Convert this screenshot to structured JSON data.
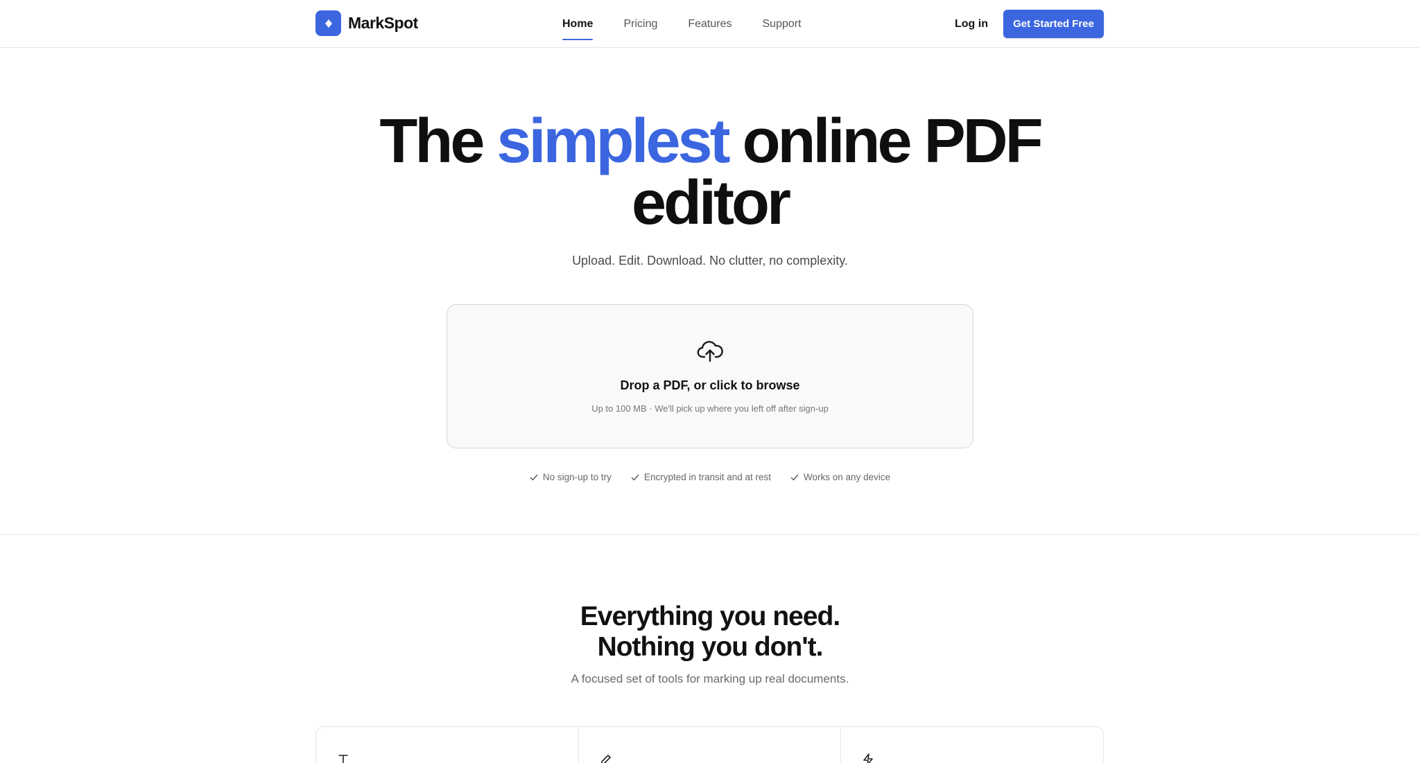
{
  "brand": {
    "name": "MarkSpot",
    "color": "#3b66e0"
  },
  "nav": {
    "items": [
      {
        "label": "Home",
        "active": true
      },
      {
        "label": "Pricing",
        "active": false
      },
      {
        "label": "Features",
        "active": false
      },
      {
        "label": "Support",
        "active": false
      }
    ],
    "login_label": "Log in",
    "cta_label": "Get Started Free"
  },
  "hero": {
    "title_before": "The ",
    "title_accent": "simplest",
    "title_after_line1": " online PDF",
    "title_line2": "editor",
    "subtitle": "Upload. Edit. Download. No clutter, no complexity."
  },
  "dropzone": {
    "icon": "cloud-upload-icon",
    "title": "Drop a PDF, or click to browse",
    "subtitle": "Up to 100 MB · We'll pick up where you left off after sign-up"
  },
  "assurances": [
    "No sign-up to try",
    "Encrypted in transit and at rest",
    "Works on any device"
  ],
  "features_section": {
    "title_line1": "Everything you need.",
    "title_line2": "Nothing you don't.",
    "subtitle": "A focused set of tools for marking up real documents.",
    "cards": [
      {
        "icon": "text-icon"
      },
      {
        "icon": "pen-icon"
      },
      {
        "icon": "lightning-icon"
      }
    ]
  }
}
